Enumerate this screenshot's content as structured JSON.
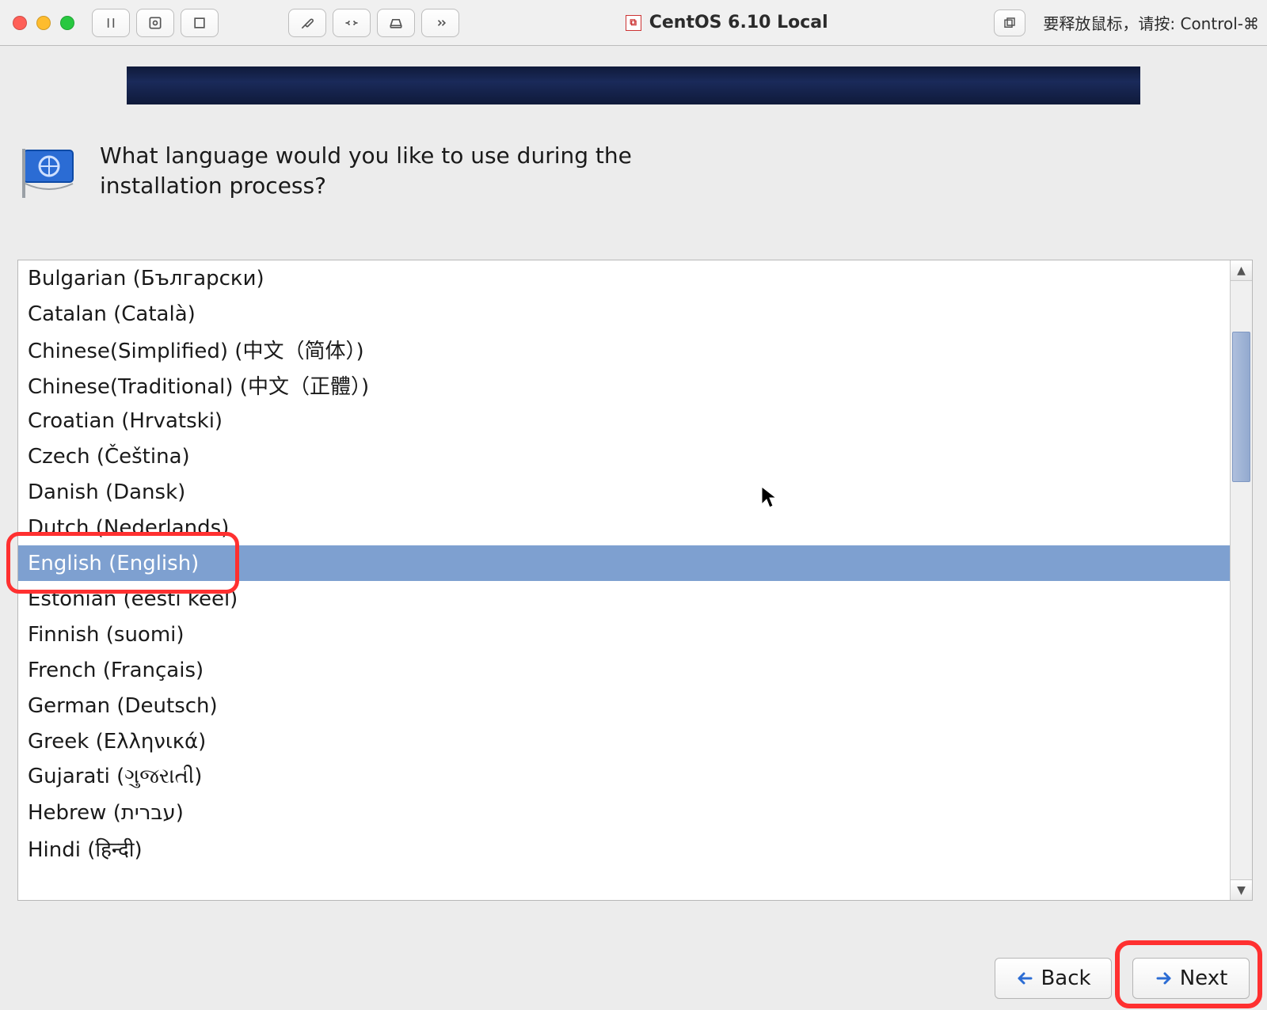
{
  "chrome": {
    "window_title": "CentOS 6.10 Local",
    "release_hint": "要释放鼠标，请按: Control-⌘"
  },
  "installer": {
    "prompt": "What language would you like to use during the installation process?",
    "selected_index": 8,
    "languages": [
      "Bulgarian (Български)",
      "Catalan (Català)",
      "Chinese(Simplified) (中文（简体）)",
      "Chinese(Traditional) (中文（正體）)",
      "Croatian (Hrvatski)",
      "Czech (Čeština)",
      "Danish (Dansk)",
      "Dutch (Nederlands)",
      "English (English)",
      "Estonian (eesti keel)",
      "Finnish (suomi)",
      "French (Français)",
      "German (Deutsch)",
      "Greek (Ελληνικά)",
      "Gujarati (ગુજરાતી)",
      "Hebrew (עברית)",
      "Hindi (हिन्दी)"
    ],
    "back_label": "Back",
    "next_label": "Next"
  }
}
